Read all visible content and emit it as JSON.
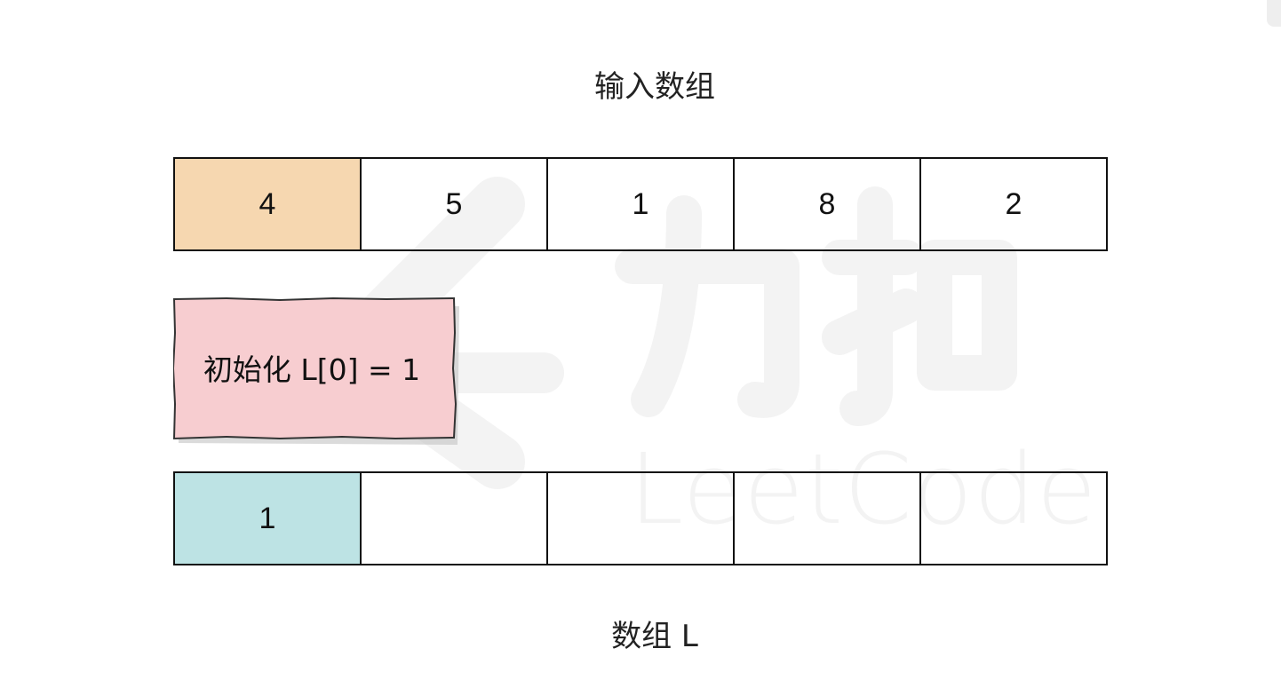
{
  "diagram": {
    "input_title": "输入数组",
    "input_cells": [
      "4",
      "5",
      "1",
      "8",
      "2"
    ],
    "note_text": "初始化 L[0] = 1",
    "output_cells": [
      "1",
      "",
      "",
      "",
      ""
    ],
    "output_title": "数组 L",
    "watermark_text": "LeetCode"
  },
  "colors": {
    "input_highlight": "#f6d7b0",
    "output_highlight": "#bde3e4",
    "note_fill": "#f7cdd0",
    "watermark": "#f3f3f3"
  },
  "icons": [
    "leetcode-logo-watermark"
  ]
}
